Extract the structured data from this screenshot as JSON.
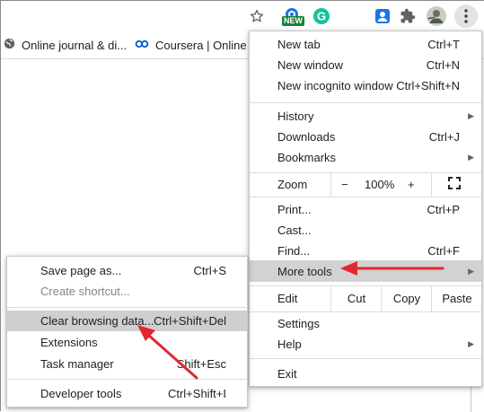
{
  "toolbar": {
    "badge_new": "NEW",
    "icons": [
      "star-icon",
      "extension-badge-icon",
      "grammarly-icon",
      "person-extension-icon",
      "puzzle-icon",
      "avatar",
      "kebab-menu-icon"
    ]
  },
  "bookmarks": [
    {
      "label": "Online journal & di...",
      "icon": "globe-icon"
    },
    {
      "label": "Coursera | Online C",
      "icon": "coursera-icon"
    }
  ],
  "main_menu": {
    "new_tab": {
      "label": "New tab",
      "shortcut": "Ctrl+T"
    },
    "new_window": {
      "label": "New window",
      "shortcut": "Ctrl+N"
    },
    "incognito": {
      "label": "New incognito window",
      "shortcut": "Ctrl+Shift+N"
    },
    "history": {
      "label": "History"
    },
    "downloads": {
      "label": "Downloads",
      "shortcut": "Ctrl+J"
    },
    "bookmarks": {
      "label": "Bookmarks"
    },
    "zoom": {
      "label": "Zoom",
      "minus": "−",
      "value": "100%",
      "plus": "+"
    },
    "print": {
      "label": "Print...",
      "shortcut": "Ctrl+P"
    },
    "cast": {
      "label": "Cast..."
    },
    "find": {
      "label": "Find...",
      "shortcut": "Ctrl+F"
    },
    "more_tools": {
      "label": "More tools"
    },
    "edit": {
      "label": "Edit",
      "cut": "Cut",
      "copy": "Copy",
      "paste": "Paste"
    },
    "settings": {
      "label": "Settings"
    },
    "help": {
      "label": "Help"
    },
    "exit": {
      "label": "Exit"
    }
  },
  "sub_menu": {
    "save_page": {
      "label": "Save page as...",
      "shortcut": "Ctrl+S"
    },
    "create_shortcut": {
      "label": "Create shortcut..."
    },
    "clear_browsing": {
      "label": "Clear browsing data...",
      "shortcut": "Ctrl+Shift+Del"
    },
    "extensions": {
      "label": "Extensions"
    },
    "task_manager": {
      "label": "Task manager",
      "shortcut": "Shift+Esc"
    },
    "developer_tools": {
      "label": "Developer tools",
      "shortcut": "Ctrl+Shift+I"
    }
  },
  "colors": {
    "annotation_arrow": "#e0282e",
    "highlight": "#d2d2d2"
  }
}
